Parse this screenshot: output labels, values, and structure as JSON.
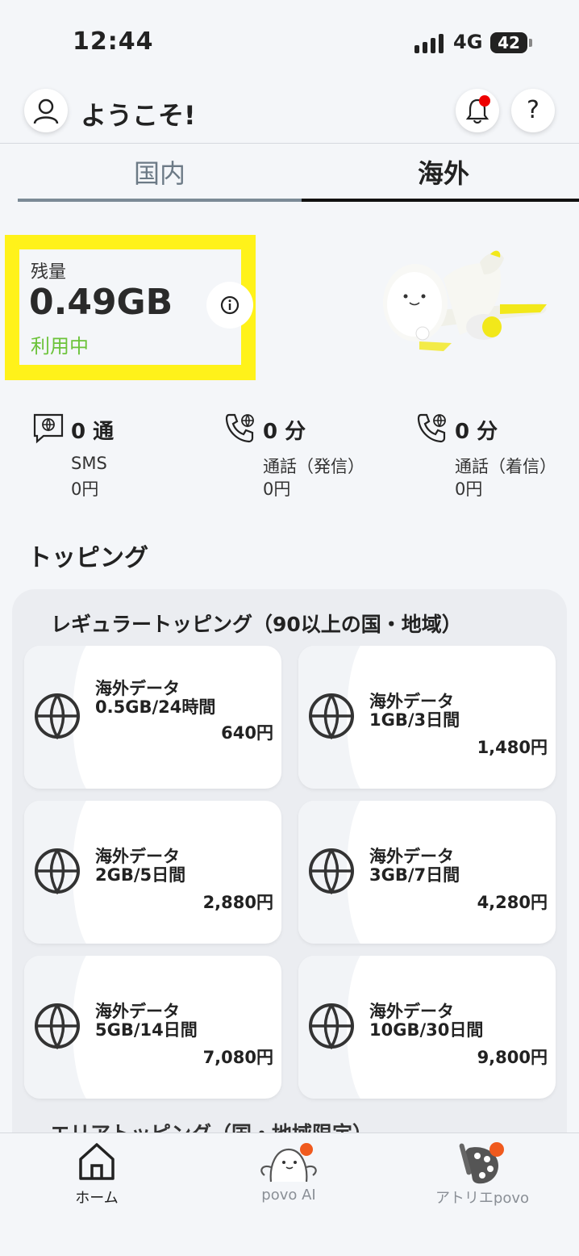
{
  "status_bar": {
    "time": "12:44",
    "network": "4G",
    "battery": "42"
  },
  "header": {
    "welcome": "ようこそ!",
    "help_label": "?"
  },
  "tabs": [
    {
      "label": "国内",
      "active": false
    },
    {
      "label": "海外",
      "active": true
    }
  ],
  "remaining": {
    "label": "残量",
    "value": "0.49GB",
    "status": "利用中"
  },
  "usage": [
    {
      "count": "0 通",
      "label": "SMS",
      "fee": "0円",
      "icon": "sms-icon"
    },
    {
      "count": "0 分",
      "label": "通話（発信）",
      "fee": "0円",
      "icon": "phone-globe-icon"
    },
    {
      "count": "0 分",
      "label": "通話（着信）",
      "fee": "0円",
      "icon": "phone-globe-icon"
    }
  ],
  "topping": {
    "section_title": "トッピング",
    "regular_title": "レギュラートッピング（90以上の国・地域）",
    "cards": [
      {
        "name": "海外データ",
        "plan": "0.5GB/24時間",
        "price": "640円"
      },
      {
        "name": "海外データ",
        "plan": "1GB/3日間",
        "price": "1,480円"
      },
      {
        "name": "海外データ",
        "plan": "2GB/5日間",
        "price": "2,880円"
      },
      {
        "name": "海外データ",
        "plan": "3GB/7日間",
        "price": "4,280円"
      },
      {
        "name": "海外データ",
        "plan": "5GB/14日間",
        "price": "7,080円"
      },
      {
        "name": "海外データ",
        "plan": "10GB/30日間",
        "price": "9,800円"
      }
    ],
    "area_title": "エリアトッピング（国・地域限定）"
  },
  "bottom_nav": [
    {
      "label": "ホーム",
      "icon": "home-icon",
      "active": true
    },
    {
      "label": "povo AI",
      "icon": "povo-ai-mascot-icon",
      "active": false
    },
    {
      "label": "アトリエpovo",
      "icon": "atelier-palette-icon",
      "active": false
    }
  ],
  "colors": {
    "highlight": "#fff21a",
    "active_status": "#6cc33a",
    "notification_dot": "#e00000"
  }
}
